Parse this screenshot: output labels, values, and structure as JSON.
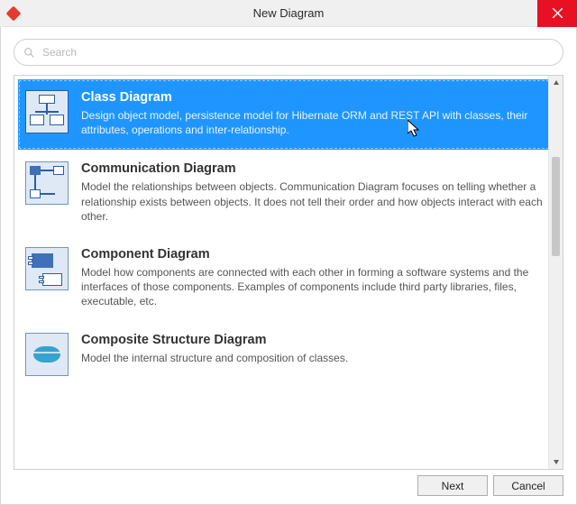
{
  "window": {
    "title": "New Diagram"
  },
  "search": {
    "placeholder": "Search",
    "value": ""
  },
  "buttons": {
    "next": "Next",
    "cancel": "Cancel"
  },
  "items": [
    {
      "title": "Class Diagram",
      "desc": "Design object model, persistence model for Hibernate ORM and REST API with classes, their attributes, operations and inter-relationship.",
      "selected": true,
      "icon": "class-diagram-icon"
    },
    {
      "title": "Communication Diagram",
      "desc": "Model the relationships between objects. Communication Diagram focuses on telling whether a relationship exists between objects. It does not tell their order and how objects interact with each other.",
      "selected": false,
      "icon": "communication-diagram-icon"
    },
    {
      "title": "Component Diagram",
      "desc": "Model how components are connected with each other in forming a software systems and the interfaces of those components. Examples of components include third party libraries, files, executable, etc.",
      "selected": false,
      "icon": "component-diagram-icon"
    },
    {
      "title": "Composite Structure Diagram",
      "desc": "Model the internal structure and composition of classes.",
      "selected": false,
      "icon": "composite-structure-diagram-icon"
    }
  ]
}
